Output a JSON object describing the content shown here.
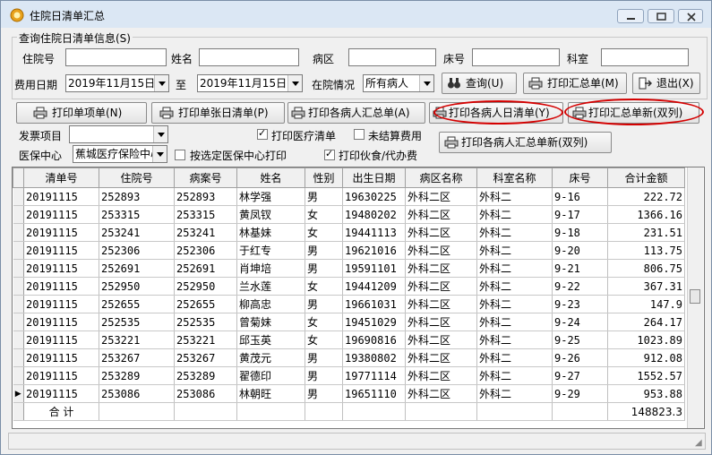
{
  "window": {
    "title": "住院日清单汇总"
  },
  "query_group": {
    "legend": "查询住院日清单信息(S)",
    "fields": {
      "admission_no_label": "住院号",
      "admission_no_value": "",
      "name_label": "姓名",
      "name_value": "",
      "ward_label": "病区",
      "ward_value": "",
      "bed_label": "床号",
      "bed_value": "",
      "dept_label": "科室",
      "dept_value": "",
      "fee_date_label": "费用日期",
      "date_from": "2019年11月15日",
      "to_label": "至",
      "date_to": "2019年11月15日",
      "status_label": "在院情况",
      "status_value": "所有病人"
    },
    "buttons": {
      "query": "查询(U)",
      "print_summary": "打印汇总单(M)",
      "exit": "退出(X)"
    }
  },
  "toolbar": {
    "print_item_list": "打印单项单(N)",
    "print_patient_daily": "打印单张日清单(P)",
    "print_patient_summary": "打印各病人汇总单(A)",
    "print_patient_daily_list": "打印各病人日清单(Y)",
    "print_summary_new": "打印汇总单新(双列)",
    "print_patient_summary_new": "打印各病人汇总单新(双列)",
    "invoice_label": "发票项目",
    "invoice_value": "",
    "insurance_label": "医保中心",
    "insurance_value": "蕉城医疗保险中心",
    "chk_print_medical": "打印医疗清单",
    "chk_unsettled": "未结算费用",
    "chk_by_center": "按选定医保中心打印",
    "chk_print_meal": "打印伙食/代办费",
    "chk_print_medical_checked": true,
    "chk_unsettled_checked": false,
    "chk_by_center_checked": false,
    "chk_print_meal_checked": true
  },
  "grid": {
    "columns": [
      "清单号",
      "住院号",
      "病案号",
      "姓名",
      "性别",
      "出生日期",
      "病区名称",
      "科室名称",
      "床号",
      "合计金额"
    ],
    "rows": [
      [
        "20191115",
        "252893",
        "252893",
        "林学强",
        "男",
        "19630225",
        "外科二区",
        "外科二",
        "9-16",
        "222.72"
      ],
      [
        "20191115",
        "253315",
        "253315",
        "黄凤钗",
        "女",
        "19480202",
        "外科二区",
        "外科二",
        "9-17",
        "1366.16"
      ],
      [
        "20191115",
        "253241",
        "253241",
        "林基妹",
        "女",
        "19441113",
        "外科二区",
        "外科二",
        "9-18",
        "231.51"
      ],
      [
        "20191115",
        "252306",
        "252306",
        "于红专",
        "男",
        "19621016",
        "外科二区",
        "外科二",
        "9-20",
        "113.75"
      ],
      [
        "20191115",
        "252691",
        "252691",
        "肖坤培",
        "男",
        "19591101",
        "外科二区",
        "外科二",
        "9-21",
        "806.75"
      ],
      [
        "20191115",
        "252950",
        "252950",
        "兰水莲",
        "女",
        "19441209",
        "外科二区",
        "外科二",
        "9-22",
        "367.31"
      ],
      [
        "20191115",
        "252655",
        "252655",
        "柳高忠",
        "男",
        "19661031",
        "外科二区",
        "外科二",
        "9-23",
        "147.9"
      ],
      [
        "20191115",
        "252535",
        "252535",
        "曾菊妹",
        "女",
        "19451029",
        "外科二区",
        "外科二",
        "9-24",
        "264.17"
      ],
      [
        "20191115",
        "253221",
        "253221",
        "邱玉英",
        "女",
        "19690816",
        "外科二区",
        "外科二",
        "9-25",
        "1023.89"
      ],
      [
        "20191115",
        "253267",
        "253267",
        "黄茂元",
        "男",
        "19380802",
        "外科二区",
        "外科二",
        "9-26",
        "912.08"
      ],
      [
        "20191115",
        "253289",
        "253289",
        "翟德印",
        "男",
        "19771114",
        "外科二区",
        "外科二",
        "9-27",
        "1552.57"
      ],
      [
        "20191115",
        "253086",
        "253086",
        "林朝旺",
        "男",
        "19651110",
        "外科二区",
        "外科二",
        "9-29",
        "953.88"
      ]
    ],
    "current_row_marker": "▶",
    "total_label": "合 计",
    "total_value": "148823.3"
  },
  "colors": {
    "highlight_oval": "#d40000",
    "titlebar": "#dbe7f4"
  }
}
